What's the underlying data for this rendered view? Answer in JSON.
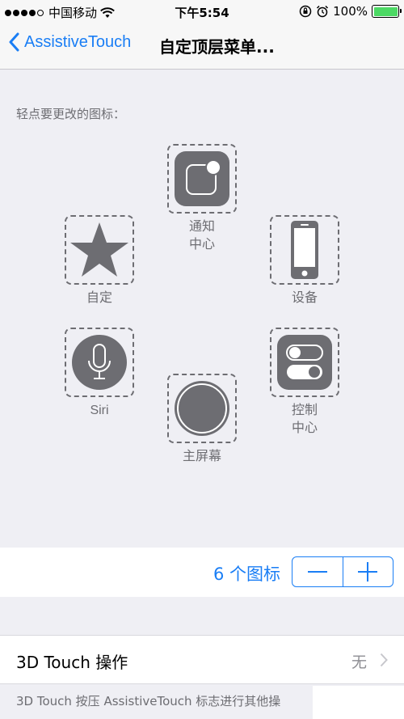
{
  "status_bar": {
    "carrier": "中国移动",
    "time": "下午5:54",
    "battery_percent": "100%",
    "battery_level": 1.0,
    "battery_color": "#4cd964"
  },
  "nav": {
    "back_label": "AssistiveTouch",
    "title": "自定顶层菜单..."
  },
  "instructions": "轻点要更改的图标：",
  "icons": {
    "notification_center": {
      "label_line1": "通知",
      "label_line2": "中心",
      "icon": "notification-center-icon"
    },
    "custom": {
      "label": "自定",
      "icon": "star-icon"
    },
    "device": {
      "label": "设备",
      "icon": "iphone-device-icon"
    },
    "siri": {
      "label": "Siri",
      "icon": "microphone-icon"
    },
    "control_center": {
      "label_line1": "控制",
      "label_line2": "中心",
      "icon": "toggle-switches-icon"
    },
    "home": {
      "label": "主屏幕",
      "icon": "home-button-icon"
    }
  },
  "icon_count": {
    "label": "6 个图标",
    "minus_icon": "minus-icon",
    "plus_icon": "plus-icon"
  },
  "touch_3d": {
    "label": "3D Touch 操作",
    "value": "无"
  },
  "footnote": "3D Touch 按压 AssistiveTouch 标志进行其他操",
  "colors": {
    "accent": "#1a7ef5",
    "icon_gray": "#6d6d72",
    "background": "#efeff4"
  }
}
